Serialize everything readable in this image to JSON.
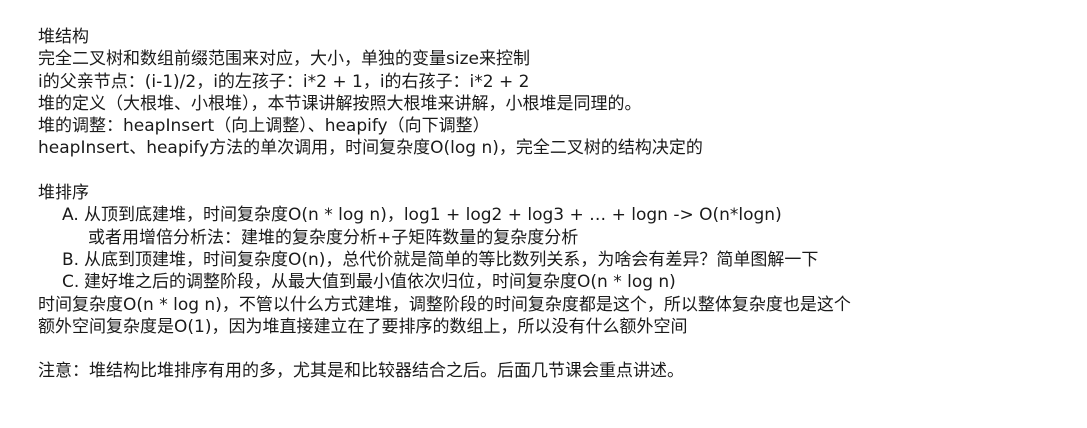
{
  "heap_section": {
    "title": "堆结构",
    "lines": [
      "完全二叉树和数组前缀范围来对应，大小，单独的变量size来控制",
      "i的父亲节点：(i-1)/2，i的左孩子：i*2 + 1，i的右孩子：i*2 + 2",
      "堆的定义（大根堆、小根堆），本节课讲解按照大根堆来讲解，小根堆是同理的。",
      "堆的调整：heapInsert（向上调整）、heapify（向下调整）",
      "heapInsert、heapify方法的单次调用，时间复杂度O(log n)，完全二叉树的结构决定的"
    ]
  },
  "heapsort_section": {
    "title": "堆排序",
    "items": [
      {
        "marker": "A.",
        "text": "从顶到底建堆，时间复杂度O(n * log n)，log1 + log2 + log3 + … + logn -> O(n*logn)",
        "continuation": "或者用增倍分析法：建堆的复杂度分析+子矩阵数量的复杂度分析"
      },
      {
        "marker": "B.",
        "text": "从底到顶建堆，时间复杂度O(n)，总代价就是简单的等比数列关系，为啥会有差异？简单图解一下"
      },
      {
        "marker": "C.",
        "text": "建好堆之后的调整阶段，从最大值到最小值依次归位，时间复杂度O(n * log n)"
      }
    ],
    "summary_lines": [
      "时间复杂度O(n * log n)，不管以什么方式建堆，调整阶段的时间复杂度都是这个，所以整体复杂度也是这个",
      "额外空间复杂度是O(1)，因为堆直接建立在了要排序的数组上，所以没有什么额外空间"
    ]
  },
  "note": "注意：堆结构比堆排序有用的多，尤其是和比较器结合之后。后面几节课会重点讲述。"
}
